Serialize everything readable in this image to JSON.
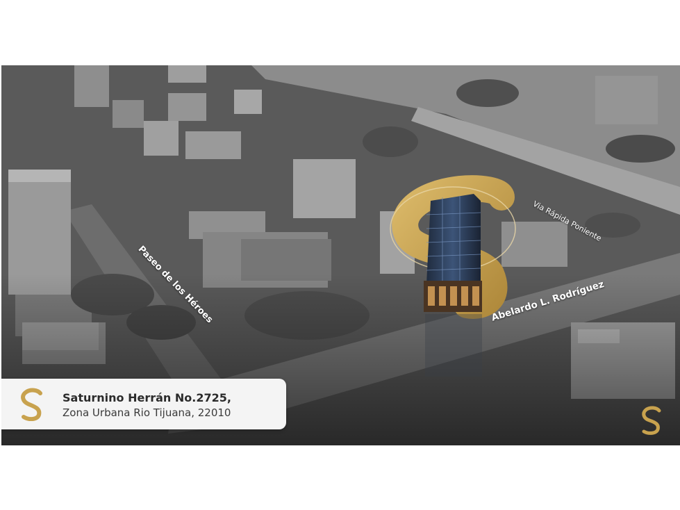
{
  "brand": {
    "logo_icon": "s-monogram-logo",
    "gold_color": "#c8a24e",
    "dark_bg": "#2b2b2b"
  },
  "map": {
    "streets": {
      "paseo": "Paseo de los Héroes",
      "abelardo": "Abelardo L. Rodríguez",
      "via_rapida": "Via Rápida Poniente"
    }
  },
  "address": {
    "line1": "Saturnino Herrán No.2725,",
    "line2": "Zona Urbana Rio Tijuana, 22010"
  }
}
